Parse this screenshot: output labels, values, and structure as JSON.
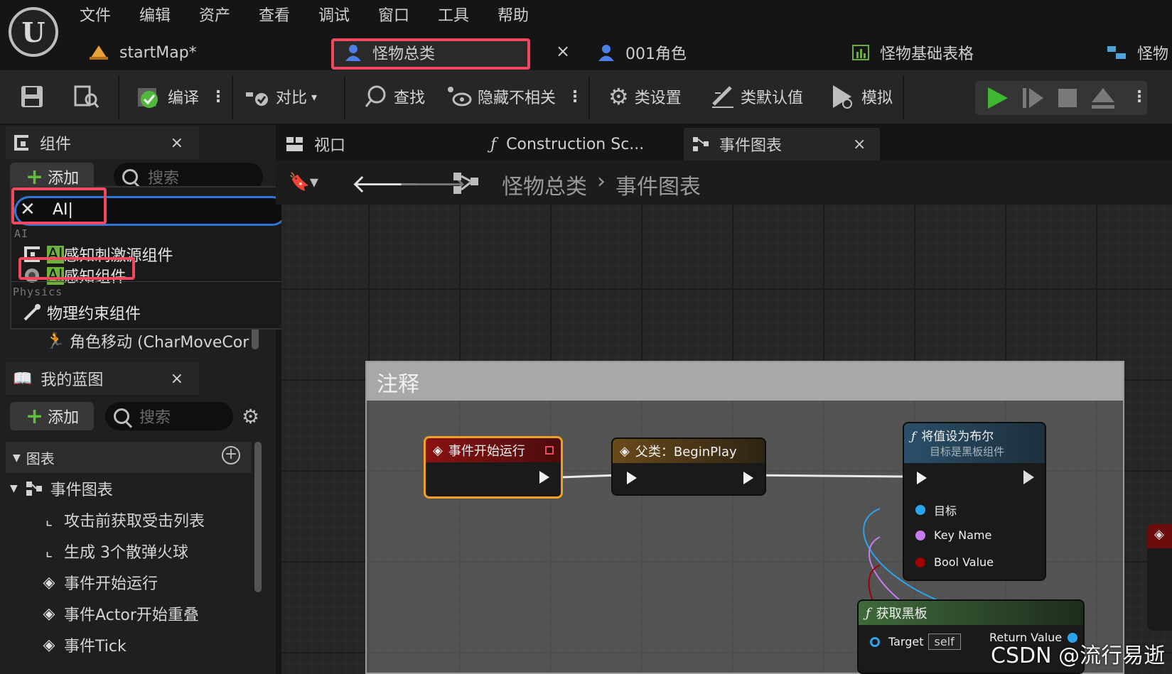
{
  "menu": [
    "文件",
    "编辑",
    "资产",
    "查看",
    "调试",
    "窗口",
    "工具",
    "帮助"
  ],
  "doc_tabs": {
    "start_map": "startMap*",
    "active": "怪物总类",
    "close": "×",
    "role": "001角色",
    "table": "怪物基础表格",
    "more": "怪物"
  },
  "toolbar": {
    "compile": "编译",
    "diff": "对比",
    "find": "查找",
    "hide_unrelated": "隐藏不相关",
    "class_settings": "类设置",
    "class_defaults": "类默认值",
    "simulate": "模拟",
    "kebab": "⋮"
  },
  "components_panel": {
    "title": "组件",
    "close": "×",
    "add_label": "添加",
    "search_placeholder": "搜索",
    "search_value": "AI",
    "category_ai": "AI",
    "items_ai": [
      {
        "hl": "AI",
        "rest": "感知刺激源组件"
      },
      {
        "hl": "AI",
        "rest": "感知组件"
      }
    ],
    "category_physics": "Physics",
    "items_physics": [
      "物理约束组件"
    ],
    "behind_item": "角色移动 (CharMoveCor"
  },
  "blueprint_panel": {
    "title": "我的蓝图",
    "close": "×",
    "add_label": "添加",
    "search_placeholder": "搜索",
    "section_graphs": "图表",
    "event_graph": "事件图表",
    "items": [
      "攻击前获取受击列表",
      "生成 3个散弹火球",
      "事件开始运行",
      "事件Actor开始重叠",
      "事件Tick"
    ]
  },
  "graph_tabs": {
    "viewport": "视口",
    "construction": "Construction Sc...",
    "event_graph": "事件图表",
    "close": "×"
  },
  "breadcrumb": {
    "root": "怪物总类",
    "sep": "›",
    "current": "事件图表"
  },
  "graph": {
    "comment_title": "注释",
    "node_begin": "事件开始运行",
    "node_parent": "父类：BeginPlay",
    "node_setbool_title": "将值设为布尔",
    "node_setbool_sub": "目标是黑板组件",
    "pin_target": "目标",
    "pin_keyname": "Key Name",
    "pin_boolvalue": "Bool Value",
    "node_getbb": "获取黑板",
    "pin_target_en": "Target",
    "pin_self": "self",
    "pin_return": "Return Value"
  },
  "watermark": "CSDN @流行易逝",
  "colors": {
    "highlight_red": "#f0485f",
    "search_match": "#6db23a",
    "play_green": "#3fb72f",
    "event_head": "#7a1010",
    "function_head": "#2b4f6a",
    "object_pin": "#2aa6f0",
    "name_pin": "#c77bf0",
    "bool_pin": "#a00000"
  }
}
